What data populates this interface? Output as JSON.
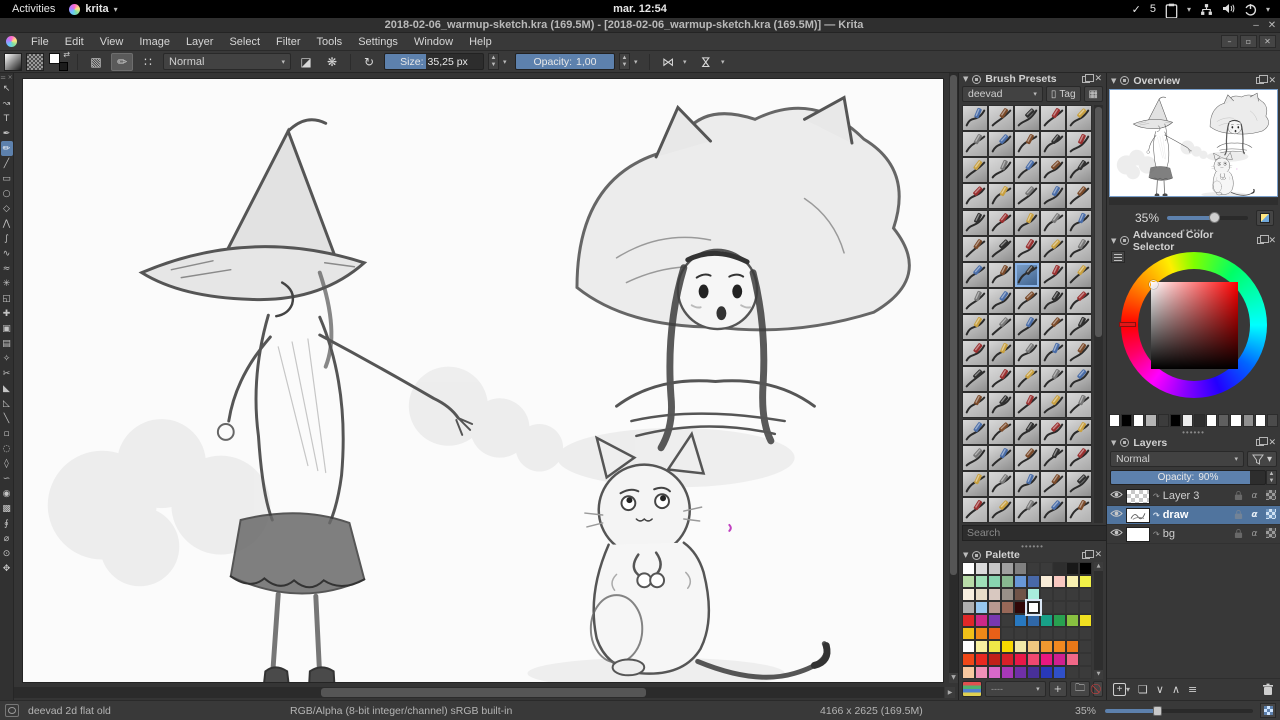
{
  "colors": {
    "accent": "#5d81ad",
    "selection_blue": "#50749e",
    "canvas_paper": "#fbfbfb",
    "topbar_bg": "#000000"
  },
  "topbar": {
    "activities": "Activities",
    "app_button": "krita",
    "clock": "mar. 12:54",
    "indicator_check": "✓",
    "indicator_count": "5"
  },
  "titlebar": {
    "title": "2018-02-06_warmup-sketch.kra (169.5M)  - [2018-02-06_warmup-sketch.kra (169.5M)] — Krita",
    "minimize": "–",
    "close": "✕"
  },
  "menubar": {
    "items": [
      "File",
      "Edit",
      "View",
      "Image",
      "Layer",
      "Select",
      "Filter",
      "Tools",
      "Settings",
      "Window",
      "Help"
    ],
    "mdi_buttons": [
      "–",
      "▫",
      "✕"
    ]
  },
  "toolbar": {
    "blending_mode": "Normal",
    "size_label": "Size:",
    "size_value": "35,25 px",
    "size_fill_pct": 42,
    "opacity_label": "Opacity:",
    "opacity_value": "1,00",
    "opacity_fill_pct": 100
  },
  "toolbox": {
    "tools": [
      {
        "name": "select-shapes",
        "glyph": "↖"
      },
      {
        "name": "edit-shapes",
        "glyph": "↝"
      },
      {
        "name": "text",
        "glyph": "T"
      },
      {
        "name": "calligraphy",
        "glyph": "✒"
      },
      {
        "name": "freehand-brush",
        "glyph": "✏",
        "active": true
      },
      {
        "name": "line",
        "glyph": "╱"
      },
      {
        "name": "rectangle",
        "glyph": "▭"
      },
      {
        "name": "ellipse",
        "glyph": "○"
      },
      {
        "name": "polygon",
        "glyph": "◇"
      },
      {
        "name": "polyline",
        "glyph": "⋀"
      },
      {
        "name": "bezier-curve",
        "glyph": "∫"
      },
      {
        "name": "freehand-path",
        "glyph": "∿"
      },
      {
        "name": "dynamic-brush",
        "glyph": "≈"
      },
      {
        "name": "multibrush",
        "glyph": "✳"
      },
      {
        "name": "transform",
        "glyph": "◱"
      },
      {
        "name": "move",
        "glyph": "✚"
      },
      {
        "name": "crop",
        "glyph": "▣"
      },
      {
        "name": "gradient",
        "glyph": "▤"
      },
      {
        "name": "color-sampler",
        "glyph": "✧"
      },
      {
        "name": "smart-patch",
        "glyph": "✂"
      },
      {
        "name": "fill",
        "glyph": "◣"
      },
      {
        "name": "assistants",
        "glyph": "◺"
      },
      {
        "name": "measure",
        "glyph": "╲"
      },
      {
        "name": "rect-select",
        "glyph": "▫"
      },
      {
        "name": "ellipse-select",
        "glyph": "◌"
      },
      {
        "name": "polygon-select",
        "glyph": "◊"
      },
      {
        "name": "freehand-select",
        "glyph": "∽"
      },
      {
        "name": "similar-select",
        "glyph": "◉"
      },
      {
        "name": "contiguous-select",
        "glyph": "▩"
      },
      {
        "name": "bezier-select",
        "glyph": "∮"
      },
      {
        "name": "magnetic-select",
        "glyph": "⌀"
      },
      {
        "name": "zoom",
        "glyph": "⊙"
      },
      {
        "name": "pan",
        "glyph": "✥"
      }
    ]
  },
  "brush_presets": {
    "title": "Brush Presets",
    "tag_filter": "deevad",
    "tag_button": "Tag",
    "search_placeholder": "Search",
    "grid": {
      "cols": 5,
      "rows": 16,
      "selected_index": 32
    }
  },
  "palette": {
    "title": "Palette",
    "selected": {
      "row": 3,
      "col": 5
    },
    "rows": [
      [
        "#ffffff",
        "#dcdcdc",
        "#c8c8c8",
        "#a0a0a0",
        "#808080",
        null,
        null,
        "#2e2e2e",
        "#181818",
        "#000000"
      ],
      [
        "#b8dca8",
        "#a0e0b8",
        "#88d4b0",
        "#88b890",
        "#6898d8",
        "#4868a8",
        "#f8ecd8",
        "#f8c8c0",
        "#f8f0b0",
        "#f0f048"
      ],
      [
        "#f8f0e0",
        "#e8ddc8",
        "#d8c8c0",
        "#989088",
        "#705448",
        "#a8ecdc",
        null,
        null,
        null,
        null
      ],
      [
        "#b0b0b0",
        "#98c8f0",
        "#b89890",
        "#986858",
        "#300808",
        "#ffffff",
        null,
        null,
        null,
        null
      ],
      [
        "#e02828",
        "#cc2888",
        "#7838b0",
        null,
        "#2878c0",
        "#3068a8",
        "#18a088",
        "#28a050",
        "#88c040",
        "#f0e020"
      ],
      [
        "#f0c018",
        "#f08818",
        "#e86018",
        null,
        null,
        null,
        null,
        null,
        null,
        null
      ],
      [
        "#ffffff",
        "#f8f0a0",
        "#f0e848",
        "#f8d800",
        "#f0e8a8",
        "#f0c880",
        "#f09830",
        "#f08820",
        "#e87818",
        null
      ],
      [
        "#f04818",
        "#e82820",
        "#c02018",
        "#d82028",
        "#e81848",
        "#f04870",
        "#e81880",
        "#d02090",
        "#f06888",
        null
      ],
      [
        "#f8c8a0",
        "#f090b8",
        "#d868c8",
        "#a838b8",
        "#7030a8",
        "#483098",
        "#2838b8",
        "#3050c8",
        null,
        null
      ]
    ]
  },
  "overview": {
    "title": "Overview",
    "zoom_label": "35%",
    "slider_pct": 58
  },
  "color_selector": {
    "title": "Advanced Color Selector",
    "history_swatches": [
      "#ffffff",
      "#000000",
      "#ffffff",
      "#b4b4b4",
      "#3c3c3c",
      "#000000",
      "#ededed",
      "#2e2e2e",
      "#ffffff",
      "#5f5f5f",
      "#ffffff",
      "#8f8f8f",
      "#ffffff",
      "#4b4b4b"
    ]
  },
  "layers": {
    "title": "Layers",
    "blending_mode": "Normal",
    "opacity_label": "Opacity:",
    "opacity_value": "90%",
    "opacity_pct": 90,
    "items": [
      {
        "name": "Layer 3",
        "thumb": "checker",
        "selected": false
      },
      {
        "name": "draw",
        "thumb": "sketch",
        "selected": true
      },
      {
        "name": "bg",
        "thumb": "white",
        "selected": false
      }
    ]
  },
  "statusbar": {
    "brush_name": "deevad 2d flat old",
    "color_info": "RGB/Alpha (8-bit integer/channel)  sRGB built-in",
    "doc_info": "4166 x 2625 (169.5M)",
    "zoom": "35%",
    "zoom_slider_pct": 35
  }
}
